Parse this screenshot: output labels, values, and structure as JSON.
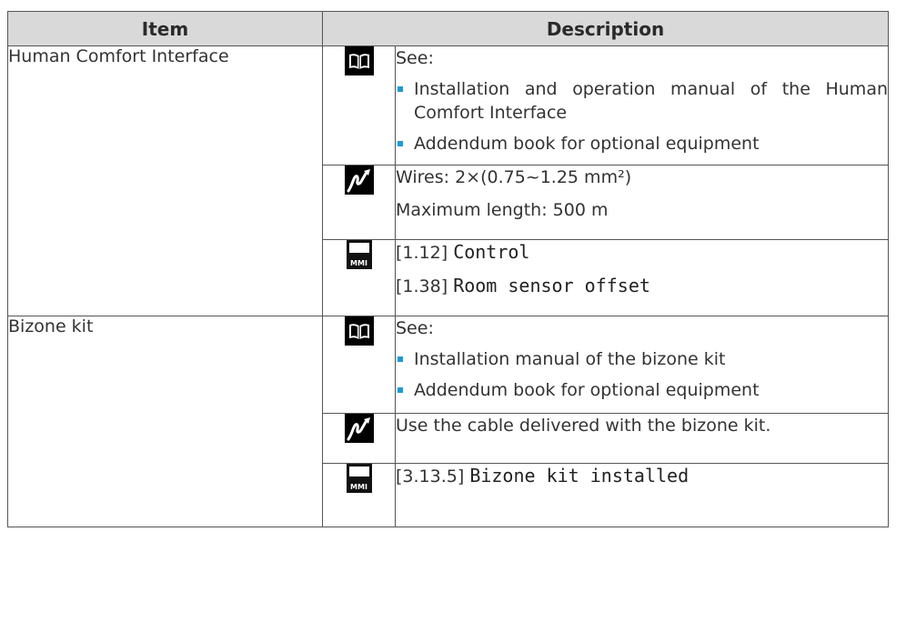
{
  "header": {
    "item": "Item",
    "description": "Description"
  },
  "rows": [
    {
      "item": "Human Comfort Interface",
      "book": {
        "icon": "manual-book-icon",
        "intro": "See:",
        "bullets": [
          "Installation and operation manual of the Human Comfort Interface",
          "Addendum book for optional equipment"
        ]
      },
      "wiring": {
        "icon": "wiring-icon",
        "lines": [
          "Wires: 2×(0.75~1.25 mm²)",
          "Maximum length: 500 m"
        ]
      },
      "settings": {
        "icon": "mmi-icon",
        "icon_label": "MMI",
        "lines": [
          {
            "code": "[1.12]",
            "name": "Control"
          },
          {
            "code": "[1.38]",
            "name": "Room sensor offset"
          }
        ]
      }
    },
    {
      "item": "Bizone kit",
      "book": {
        "icon": "manual-book-icon",
        "intro": "See:",
        "bullets": [
          "Installation manual of the bizone kit",
          "Addendum book for optional equipment"
        ]
      },
      "wiring": {
        "icon": "wiring-icon",
        "lines": [
          "Use the cable delivered with the bizone kit."
        ]
      },
      "settings": {
        "icon": "mmi-icon",
        "icon_label": "MMI",
        "lines": [
          {
            "code": "[3.13.5]",
            "name": "Bizone kit installed"
          }
        ]
      }
    }
  ],
  "colors": {
    "header_bg": "#d9d9d9",
    "bullet": "#1d9bd7",
    "border": "#555555"
  }
}
